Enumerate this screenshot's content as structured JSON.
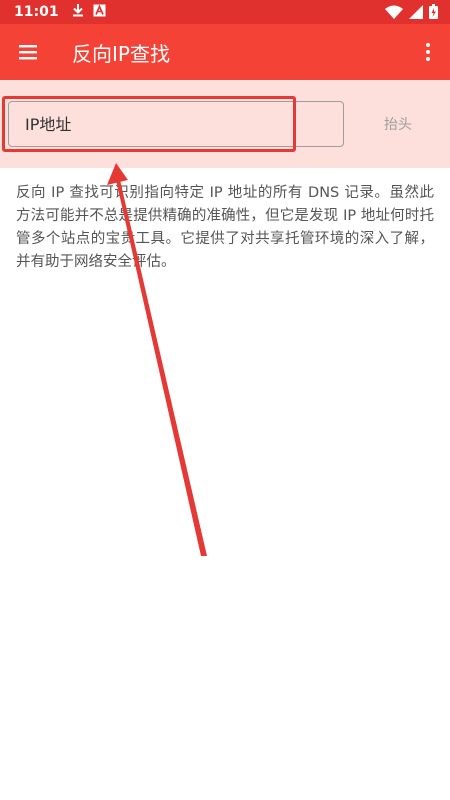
{
  "status_bar": {
    "time": "11:01",
    "icons": [
      "download-icon",
      "font-icon",
      "wifi-icon",
      "signal-icon",
      "battery-icon"
    ]
  },
  "app_bar": {
    "title": "反向IP查找",
    "menu_icon": "menu-icon",
    "overflow_icon": "more-vert-icon"
  },
  "search": {
    "placeholder": "IP地址",
    "button_label": "抬头"
  },
  "description": "反向 IP 查找可识别指向特定 IP 地址的所有 DNS 记录。虽然此方法可能并不总是提供精确的准确性，但它是发现 IP 地址何时托管多个站点的宝贵工具。它提供了对共享托管环境的深入了解，并有助于网络安全评估。",
  "colors": {
    "status_bar": "#e0312f",
    "app_bar": "#f44336",
    "search_background": "#fde0db",
    "annotation": "#e53935"
  }
}
